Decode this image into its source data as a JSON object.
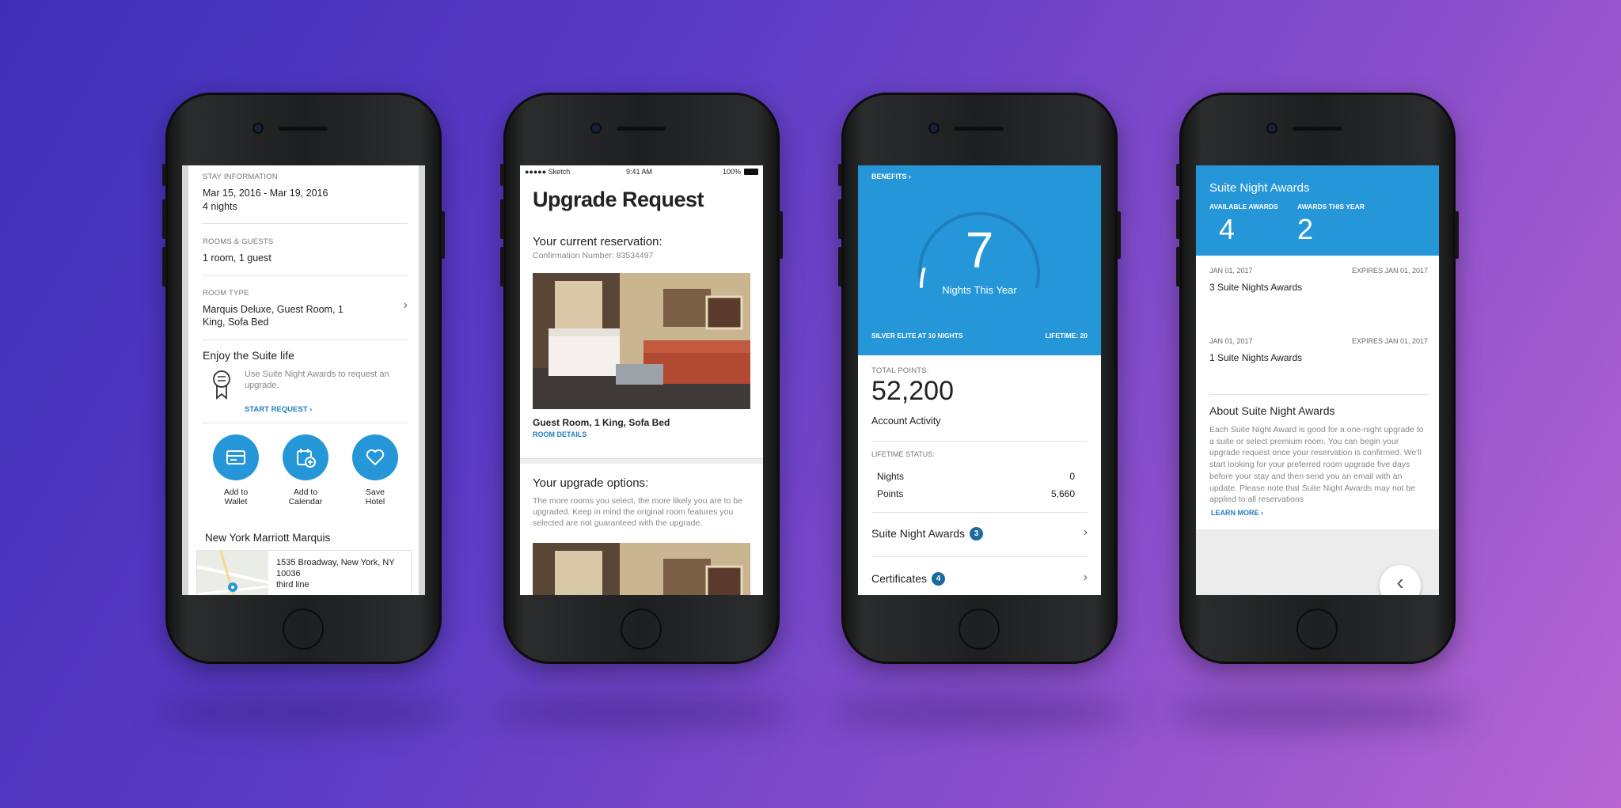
{
  "phone1": {
    "stay_label": "STAY INFORMATION",
    "stay_dates": "Mar 15, 2016 - Mar 19, 2016",
    "stay_nights": "4 nights",
    "rooms_label": "ROOMS & GUESTS",
    "rooms_value": "1 room, 1 guest",
    "roomtype_label": "ROOM TYPE",
    "roomtype_value": "Marquis Deluxe, Guest Room, 1 King, Sofa Bed",
    "suite_title": "Enjoy the Suite life",
    "suite_text": "Use Suite Night Awards to request an upgrade.",
    "start_request": "START REQUEST",
    "actions": [
      {
        "label1": "Add to",
        "label2": "Wallet",
        "icon": "wallet-icon"
      },
      {
        "label1": "Add to",
        "label2": "Calendar",
        "icon": "calendar-add-icon"
      },
      {
        "label1": "Save",
        "label2": "Hotel",
        "icon": "heart-icon"
      }
    ],
    "hotel_name": "New York Marriott Marquis",
    "address_line1": "1535 Broadway, New York, NY",
    "address_line2": "10036",
    "address_line3": "third line"
  },
  "phone2": {
    "status_carrier": "●●●●● Sketch",
    "status_time": "9:41 AM",
    "status_battery": "100%",
    "title": "Upgrade Request",
    "current_heading": "Your current reservation:",
    "confirmation": "Confirmation Number: 83534497",
    "room_name": "Guest Room, 1 King, Sofa Bed",
    "room_details": "ROOM DETAILS",
    "options_heading": "Your upgrade options:",
    "options_text": "The more rooms you select, the more likely you are to be upgraded. Keep in mind the original room features you selected are not guaranteed with the upgrade."
  },
  "phone3": {
    "benefits": "BENEFITS",
    "nights_value": "7",
    "nights_label": "Nights This Year",
    "nights_progress": 0.7,
    "elite_label": "SILVER ELITE AT 10 NIGHTS",
    "lifetime_label": "LIFETIME: 20",
    "total_points_label": "TOTAL POINTS:",
    "total_points": "52,200",
    "account_activity": "Account Activity",
    "lifetime_status_label": "LIFETIME STATUS:",
    "nights_row_label": "Nights",
    "nights_row_value": "0",
    "points_row_label": "Points",
    "points_row_value": "5,660",
    "suite_awards_label": "Suite Night Awards",
    "suite_awards_count": "3",
    "certificates_label": "Certificates",
    "certificates_count": "4"
  },
  "phone4": {
    "title": "Suite Night Awards",
    "available_label": "AVAILABLE AWARDS",
    "available_value": "4",
    "this_year_label": "AWARDS THIS YEAR",
    "this_year_value": "2",
    "awards": [
      {
        "date": "JAN 01, 2017",
        "expires": "EXPIRES JAN 01, 2017",
        "name": "3 Suite Nights Awards"
      },
      {
        "date": "JAN 01, 2017",
        "expires": "EXPIRES JAN 01, 2017",
        "name": "1 Suite Nights Awards"
      }
    ],
    "about_title": "About Suite Night Awards",
    "about_text": "Each Suite Night Award is good for a one-night upgrade to a suite or select premium room. You can begin your upgrade request once your reservation is confirmed. We'll start looking for your preferred room upgrade five days before your stay and then send you an email with an update. Please note that Suite Night Awards may not be applied to all reservations",
    "learn_more": "LEARN MORE"
  },
  "colors": {
    "primary_blue": "#2596d7",
    "badge_blue": "#1c6aa0"
  }
}
